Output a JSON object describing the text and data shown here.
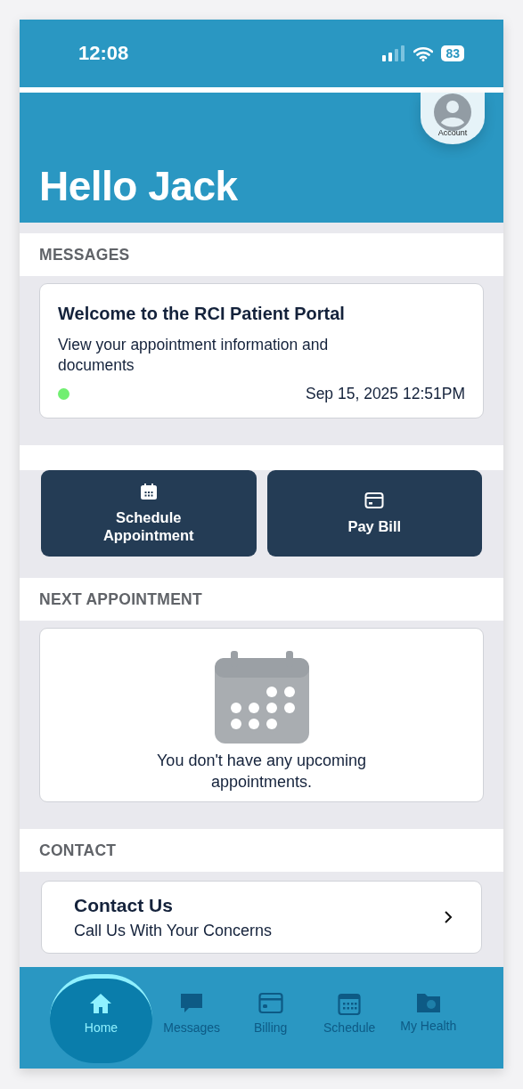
{
  "status_bar": {
    "time": "12:08",
    "battery": "83"
  },
  "header": {
    "account_label": "Account",
    "greeting": "Hello Jack"
  },
  "messages": {
    "heading": "MESSAGES",
    "items": [
      {
        "title": "Welcome to the RCI Patient Portal",
        "body": "View your appointment information and documents",
        "unread": true,
        "date": "Sep 15, 2025 12:51PM"
      }
    ]
  },
  "actions": [
    {
      "kind": "calendar",
      "label": "Schedule Appointment"
    },
    {
      "kind": "card",
      "label": "Pay Bill"
    }
  ],
  "next_appointment": {
    "heading": "NEXT APPOINTMENT",
    "empty_text": "You don't have any upcoming appointments."
  },
  "contact": {
    "heading": "CONTACT",
    "title": "Contact Us",
    "subtitle": "Call Us With Your Concerns"
  },
  "tabs": [
    {
      "kind": "home",
      "label": "Home",
      "selected": true
    },
    {
      "kind": "messages",
      "label": "Messages",
      "selected": false
    },
    {
      "kind": "billing",
      "label": "Billing",
      "selected": false
    },
    {
      "kind": "schedule",
      "label": "Schedule",
      "selected": false
    },
    {
      "kind": "health",
      "label": "My Health",
      "selected": false
    }
  ]
}
